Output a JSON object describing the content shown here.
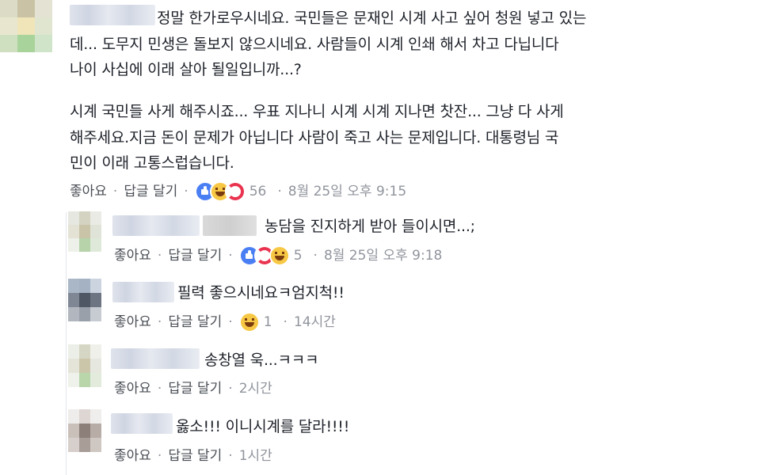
{
  "comments": [
    {
      "lines": [
        "정말 한가로우시네요. 국민들은 문재인 시계 사고 싶어 청원 넣고 있는",
        "데... 도무지 민생은 돌보지 않으시네요. 사람들이 시계 인쇄 해서 차고 다닙니다",
        "나이 사십에 이래 살아 될일입니까...?",
        "",
        "시계 국민들 사게 해주시죠... 우표 지나니 시계 시계 지나면 찻잔... 그냥 다 사게",
        "해주세요.지금 돈이 문제가 아닙니다 사람이 죽고 사는 문제입니다. 대통령님 국",
        "민이 이래 고통스럽습니다."
      ],
      "like": "좋아요",
      "reply": "답글 달기",
      "reaction_count": "56",
      "timestamp": "8월 25일 오후 9:15"
    }
  ],
  "replies": [
    {
      "text": "농담을 진지하게 받아 들이시면...;",
      "like": "좋아요",
      "reply": "답글 달기",
      "reaction_count": "5",
      "timestamp": "8월 25일 오후 9:18"
    },
    {
      "text": "필력 좋으시네요ㅋ엄지척!!",
      "like": "좋아요",
      "reply": "답글 달기",
      "reaction_count": "1",
      "timestamp": "14시간"
    },
    {
      "text": "송창열 욱...ㅋㅋㅋ",
      "like": "좋아요",
      "reply": "답글 달기",
      "timestamp": "2시간"
    },
    {
      "text": "옳소!!! 이니시계를 달라!!!!",
      "like": "좋아요",
      "reply": "답글 달기",
      "timestamp": "1시간"
    }
  ],
  "separator": "·",
  "colors": {
    "text": "#1d2129",
    "meta": "#90949c",
    "action": "#4b4f56",
    "like": "#4a7ff3",
    "haha": "#f7c845",
    "love": "#e9334f"
  }
}
